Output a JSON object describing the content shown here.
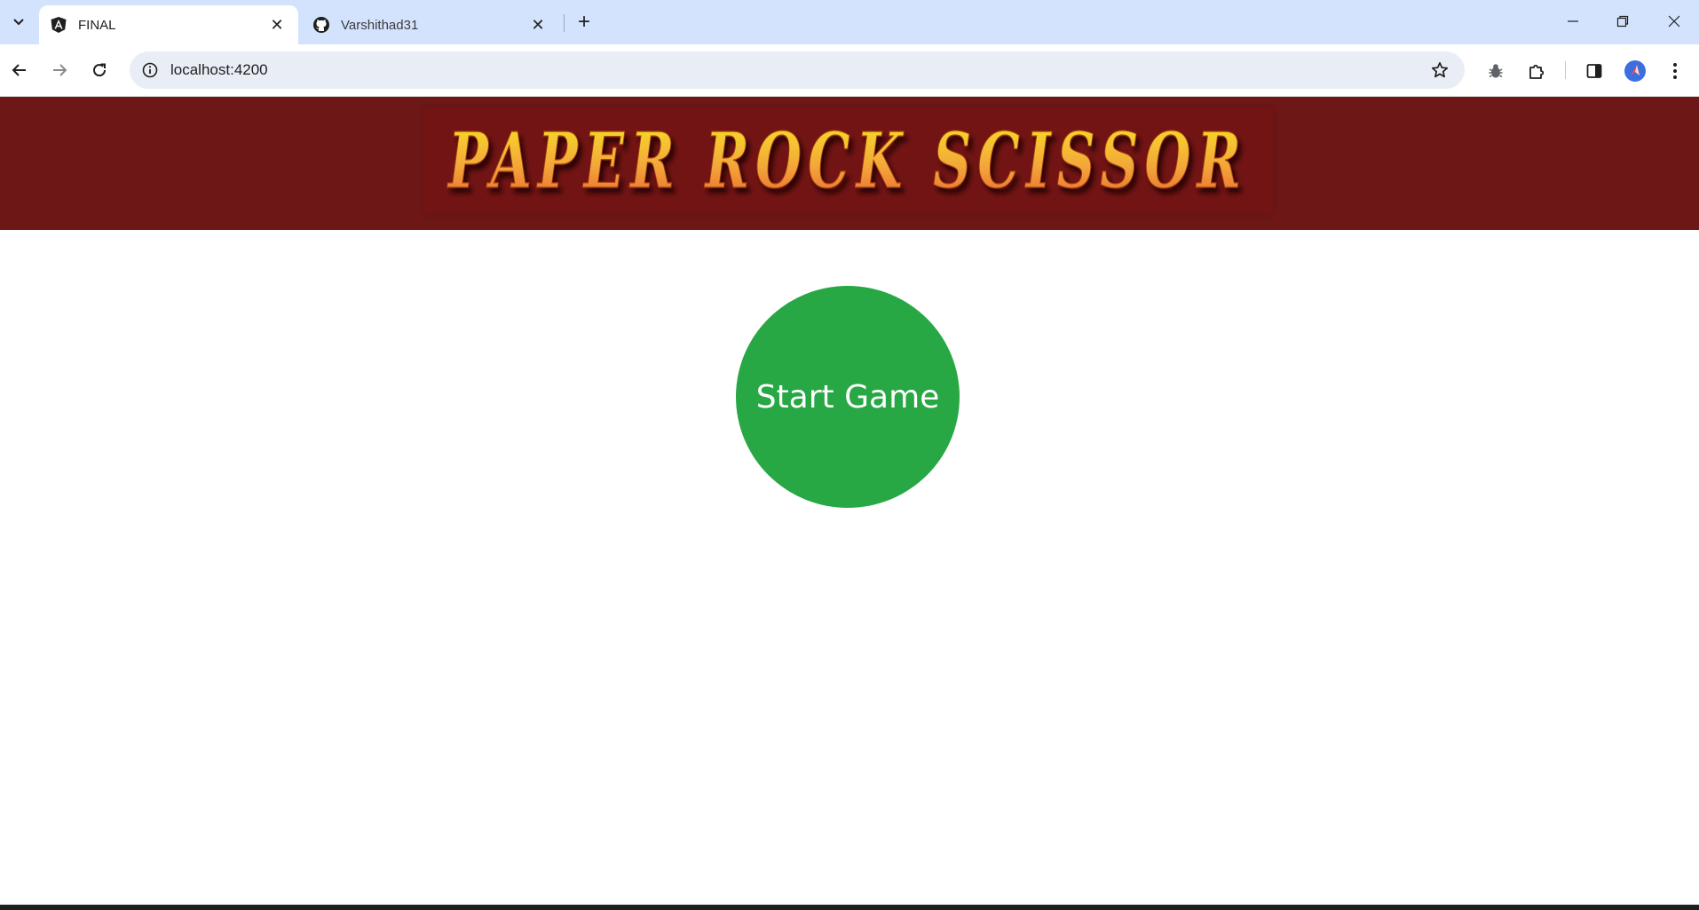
{
  "browser": {
    "tabs": [
      {
        "title": "FINAL",
        "icon": "angular-icon",
        "active": true
      },
      {
        "title": "Varshithad31",
        "icon": "github-icon",
        "active": false
      }
    ],
    "new_tab_label": "+",
    "close_glyph": "✕",
    "address": {
      "url": "localhost:4200"
    }
  },
  "header": {
    "logo_text": "PAPER ROCK SCISSOR"
  },
  "main": {
    "start_button_label": "Start Game"
  },
  "colors": {
    "tab_strip": "#d3e3fd",
    "header_bg": "#6d1717",
    "start_button": "#28a745",
    "logo_gradient_top": "#f5e623",
    "logo_gradient_bottom": "#e8622c"
  }
}
